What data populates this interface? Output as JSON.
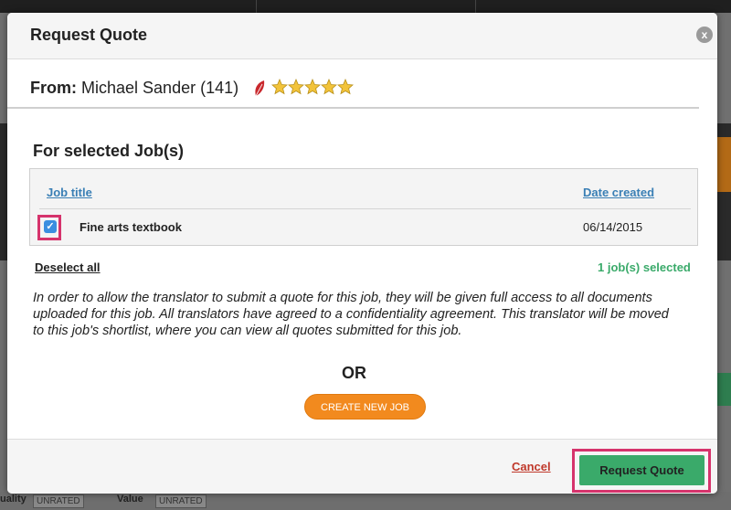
{
  "modal": {
    "title": "Request Quote",
    "close_glyph": "x",
    "from": {
      "label": "From:",
      "name": "Michael Sander (141)",
      "rating_stars": 5
    },
    "section_title": "For selected Job(s)",
    "jobs_table": {
      "columns": [
        "Job title",
        "Date created"
      ],
      "rows": [
        {
          "title": "Fine arts textbook",
          "date": "06/14/2015",
          "checked": true
        }
      ]
    },
    "deselect_all": "Deselect all",
    "selected_count": "1 job(s) selected",
    "info": "In order to allow the translator to submit a quote for this job, they will be given full access to all documents uploaded for this job. All translators have agreed to a confidentiality agreement. This translator will be moved to this job's shortlist, where you can view all quotes submitted for this job.",
    "or_label": "OR",
    "create_new_job": "CREATE NEW JOB",
    "cancel": "Cancel",
    "submit": "Request Quote"
  },
  "background": {
    "unrated_1": "UNRATED",
    "unrated_2": "UNRATED",
    "quality_label": "uality",
    "value_label": "Value"
  },
  "colors": {
    "link_blue": "#3a7fb5",
    "success_green": "#3aaa6a",
    "orange": "#f28a1e",
    "cancel_red": "#c0392b",
    "highlight_pink": "#d6336c",
    "checkbox_blue": "#3b8ee0"
  },
  "icons": {
    "close": "close-icon",
    "leaf": "leaf-icon",
    "star": "star-icon",
    "check": "checkmark-icon"
  }
}
